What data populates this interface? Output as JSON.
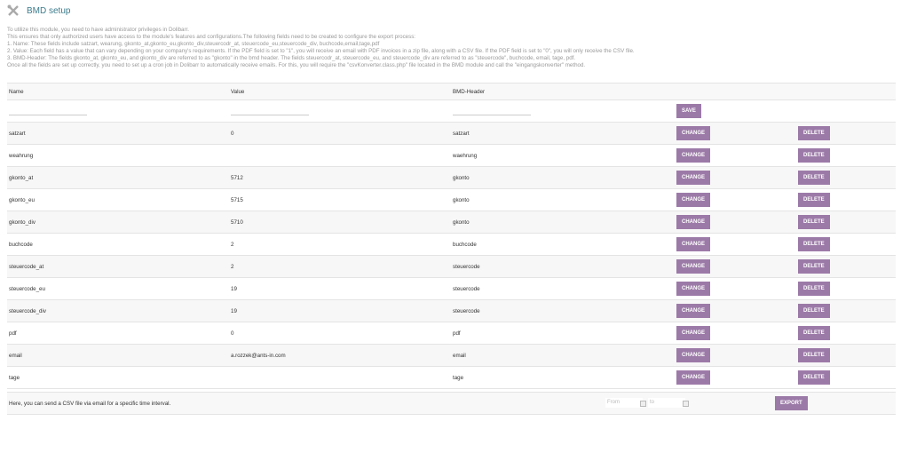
{
  "header": {
    "title": "BMD setup",
    "icon": "tools-icon"
  },
  "intro": [
    "To utilize this module, you need to have administrator privileges in Dolibarr.",
    "This ensures that only authorized users have access to the module's features and configurations.The following fields need to be created to configure the export process:",
    "1. Name: These fields include satzart, wearung, gkonto_at,gkonto_eu,gkonto_div,steuercodr_at, steuercode_eu,steuercode_div, buchcode,email,tage,pdf",
    "2. Value: Each field has a value that can vary depending on your company's requirements. If the PDF field is set to \"1\", you will receive an email with PDF invoices in a zip file, along with a CSV file. If the PDF field is set to \"0\", you will only receive the CSV file.",
    "3. BMD-Header: The fields gkonto_at, gkonto_eu, and gkonto_div are referred to as \"gkonto\" in the bmd header. The fields steuercodr_at, steuercode_eu, and steuercode_div are referred to as \"steuercode\", buchcode, email, tage, pdf.",
    "Once all the fields are set up correctly, you need to set up a cron job in Dolibarr to automatically receive emails. For this, you will require the \"csvKonverter.class.php\" file located in the BMD module and call the \"eingangskonverter\" method."
  ],
  "table": {
    "columns": [
      "Name",
      "Value",
      "BMD-Header"
    ],
    "save_label": "SAVE",
    "change_label": "CHANGE",
    "delete_label": "DELETE",
    "rows": [
      {
        "name": "satzart",
        "value": "0",
        "header": "satzart"
      },
      {
        "name": "weahrung",
        "value": "",
        "header": "waehrung"
      },
      {
        "name": "gkonto_at",
        "value": "5712",
        "header": "gkonto"
      },
      {
        "name": "gkonto_eu",
        "value": "5715",
        "header": "gkonto"
      },
      {
        "name": "gkonto_div",
        "value": "5710",
        "header": "gkonto"
      },
      {
        "name": "buchcode",
        "value": "2",
        "header": "buchcode"
      },
      {
        "name": "steuercode_at",
        "value": "2",
        "header": "steuercode"
      },
      {
        "name": "steuercode_eu",
        "value": "19",
        "header": "steuercode"
      },
      {
        "name": "steuercode_div",
        "value": "19",
        "header": "steuercode"
      },
      {
        "name": "pdf",
        "value": "0",
        "header": "pdf"
      },
      {
        "name": "email",
        "value": "a.rozzek@ants-in.com",
        "header": "email"
      },
      {
        "name": "tage",
        "value": "",
        "header": "tage"
      }
    ]
  },
  "export": {
    "text": "Here, you can send a CSV file via email for a specific time interval.",
    "from_placeholder": "From",
    "to_placeholder": "to",
    "button": "EXPORT"
  },
  "colors": {
    "accent": "#9c7aa8",
    "title": "#3d7c8c"
  }
}
